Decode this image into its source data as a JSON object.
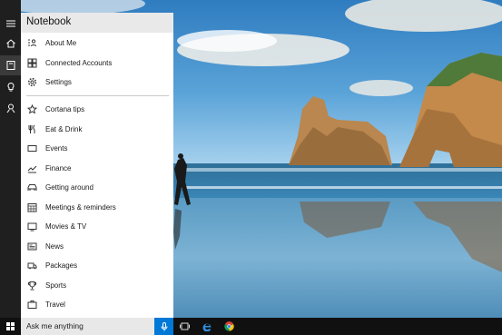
{
  "notebook": {
    "title": "Notebook",
    "top_items": [
      {
        "label": "About Me",
        "icon": "about-me-icon"
      },
      {
        "label": "Connected Accounts",
        "icon": "connected-accounts-icon"
      },
      {
        "label": "Settings",
        "icon": "gear-icon"
      }
    ],
    "items": [
      {
        "label": "Cortana tips",
        "icon": "star-icon"
      },
      {
        "label": "Eat & Drink",
        "icon": "fork-knife-icon"
      },
      {
        "label": "Events",
        "icon": "ticket-icon"
      },
      {
        "label": "Finance",
        "icon": "chart-icon"
      },
      {
        "label": "Getting around",
        "icon": "car-icon"
      },
      {
        "label": "Meetings & reminders",
        "icon": "calendar-icon"
      },
      {
        "label": "Movies & TV",
        "icon": "tv-icon"
      },
      {
        "label": "News",
        "icon": "newspaper-icon"
      },
      {
        "label": "Packages",
        "icon": "truck-icon"
      },
      {
        "label": "Sports",
        "icon": "trophy-icon"
      },
      {
        "label": "Travel",
        "icon": "suitcase-icon"
      }
    ]
  },
  "rail": {
    "items": [
      "hamburger-menu-icon",
      "home-icon",
      "notebook-icon",
      "lightbulb-icon",
      "feedback-icon"
    ]
  },
  "taskbar": {
    "search_placeholder": "Ask me anything",
    "apps": [
      "task-view-icon",
      "edge-icon",
      "chrome-icon"
    ]
  },
  "colors": {
    "accent": "#0078d7",
    "rail": "#1f1f1f",
    "taskbar": "#101010"
  }
}
